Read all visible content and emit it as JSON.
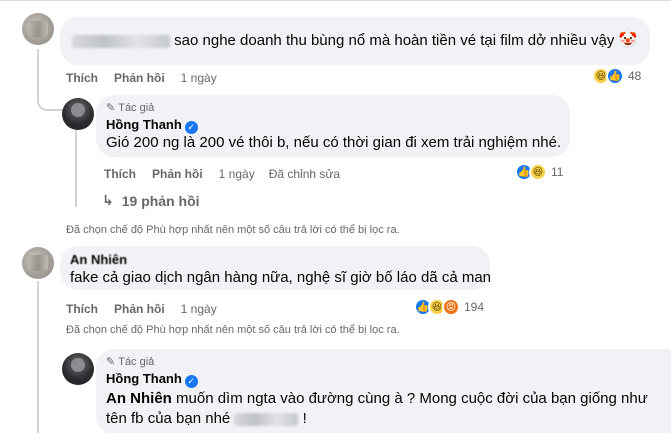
{
  "comments": [
    {
      "text": "sao nghe doanh thu bùng nổ mà hoàn tiền vé tại film dở nhiều vậy",
      "emoji": "🤡",
      "actions": {
        "like": "Thích",
        "reply": "Phản hồi",
        "time": "1 ngày"
      },
      "reaction_count": "48",
      "reply": {
        "author_tag": "Tác giả",
        "name": "Hồng Thanh",
        "text": "Gió 200 ng là 200 vé thôi b, nếu có thời gian đi xem trải nghiệm nhé.",
        "actions": {
          "like": "Thích",
          "reply": "Phản hồi",
          "time": "1 ngày",
          "edited": "Đã chỉnh sửa"
        },
        "reaction_count": "11"
      },
      "more_replies": "19 phản hồi",
      "filter_note": "Đã chọn chế độ Phù hợp nhất nên một số câu trả lời có thể bị lọc ra."
    },
    {
      "name": "An Nhiên",
      "text": "fake cả giao dịch ngân hàng nữa, nghệ sĩ giờ bố láo dã cả man",
      "actions": {
        "like": "Thích",
        "reply": "Phản hồi",
        "time": "1 ngày"
      },
      "reaction_count": "194",
      "filter_note": "Đã chọn chế độ Phù hợp nhất nên một số câu trả lời có thể bị lọc ra.",
      "reply": {
        "author_tag": "Tác giả",
        "name": "Hồng Thanh",
        "mention": "An Nhiên",
        "text_line1": " muốn dìm ngta vào đường cùng à ? Mong cuộc đời của bạn giống như",
        "text_line2": "tên fb của bạn nhé ",
        "text_end": " !"
      }
    }
  ],
  "icons": {
    "pen": "pen-icon",
    "verified": "verified-badge-icon",
    "reply_arrow": "reply-arrow-icon",
    "like": "like-reaction-icon",
    "haha": "haha-reaction-icon",
    "angry": "angry-reaction-icon"
  },
  "colors": {
    "like": "#1877f2",
    "haha": "#f7d14a",
    "angry": "#e9710f",
    "bubble": "#f0f2f5",
    "meta": "#65676b"
  }
}
